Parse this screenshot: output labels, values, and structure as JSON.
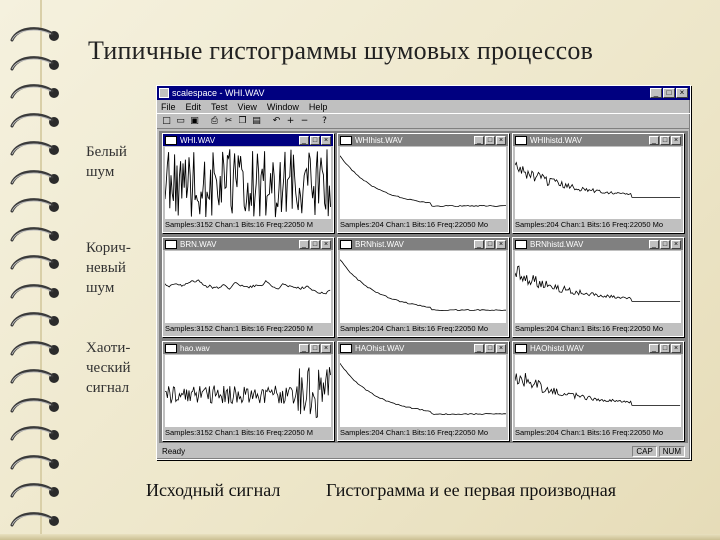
{
  "slide": {
    "title": "Типичные гистограммы шумовых процессов",
    "labels": {
      "white": [
        "Белый",
        "шум"
      ],
      "brown": [
        "Корич-",
        "невый",
        "шум"
      ],
      "chaos": [
        "Хаоти-",
        "ческий",
        "сигнал"
      ]
    },
    "captions": {
      "left": "Исходный сигнал",
      "right": "Гистограмма  и  ее  первая производная"
    }
  },
  "app": {
    "title": "scalespace - WHI.WAV",
    "menu": [
      "File",
      "Edit",
      "Test",
      "View",
      "Window",
      "Help"
    ],
    "toolbar_icons": [
      "new-icon",
      "open-icon",
      "save-icon",
      "print-icon",
      "cut-icon",
      "copy-icon",
      "paste-icon",
      "undo-icon",
      "zoom-in-icon",
      "zoom-out-icon",
      "help-icon"
    ],
    "toolbar_glyphs": [
      "□",
      "▭",
      "▣",
      "⎙",
      "✂",
      "❐",
      "▤",
      "↶",
      "+",
      "−",
      "?"
    ],
    "status_left": "Ready",
    "status_cells": [
      "CAP",
      "NUM"
    ],
    "windows": [
      {
        "title": "WHI.WAV",
        "status": "Samples:3152 Chan:1 Bits:16 Freq:22050 M",
        "kind": "noise",
        "active": true
      },
      {
        "title": "WHIhist.WAV",
        "status": "Samples:204 Chan:1 Bits:16 Freq:22050 Mo",
        "kind": "hist"
      },
      {
        "title": "WHIhistd.WAV",
        "status": "Samples:204 Chan:1 Bits:16 Freq:22050 Mo",
        "kind": "deriv"
      },
      {
        "title": "BRN.WAV",
        "status": "Samples:3152 Chan:1 Bits:16 Freq:22050 M",
        "kind": "brown"
      },
      {
        "title": "BRNhist.WAV",
        "status": "Samples:204 Chan:1 Bits:16 Freq:22050 Mo",
        "kind": "hist"
      },
      {
        "title": "BRNhistd.WAV",
        "status": "Samples:204 Chan:1 Bits:16 Freq:22050 Mo",
        "kind": "deriv"
      },
      {
        "title": "hao.wav",
        "status": "Samples:3152 Chan:1 Bits:16 Freq:22050 M",
        "kind": "chaos"
      },
      {
        "title": "HAOhist.WAV",
        "status": "Samples:204 Chan:1 Bits:16 Freq:22050 Mo",
        "kind": "hist"
      },
      {
        "title": "HAOhistd.WAV",
        "status": "Samples:204 Chan:1 Bits:16 Freq:22050 Mo",
        "kind": "deriv"
      }
    ]
  }
}
